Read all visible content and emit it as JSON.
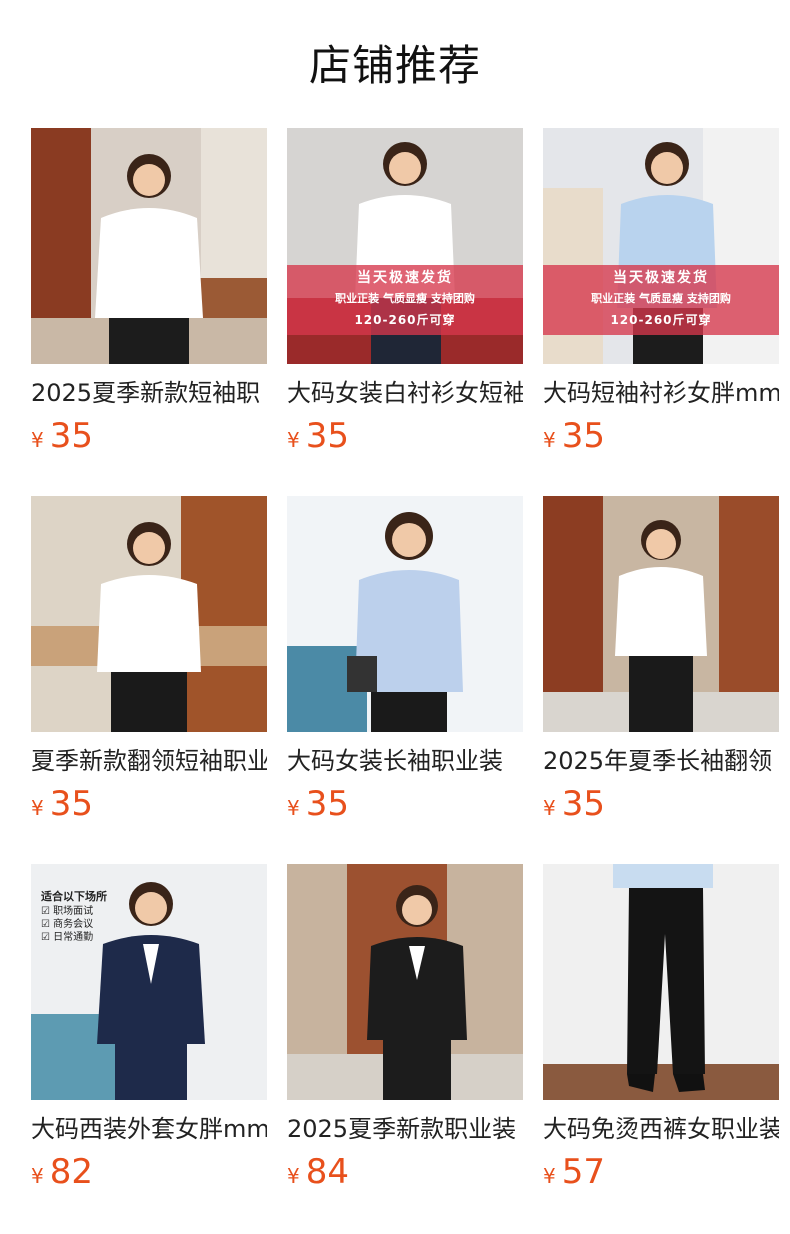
{
  "header": {
    "title": "店铺推荐"
  },
  "products": [
    {
      "name": "2025夏季新款短袖职",
      "currency": "¥",
      "price": "35"
    },
    {
      "name": "大码女装白衬衫女短袖",
      "currency": "¥",
      "price": "35",
      "banner": {
        "line1": "当天极速发货",
        "line2": "职业正装  气质显瘦  支持团购",
        "line3": "120-260斤可穿"
      }
    },
    {
      "name": "大码短袖衬衫女胖mm",
      "currency": "¥",
      "price": "35",
      "banner": {
        "line1": "当天极速发货",
        "line2": "职业正装  气质显瘦  支持团购",
        "line3": "120-260斤可穿"
      }
    },
    {
      "name": "夏季新款翻领短袖职业",
      "currency": "¥",
      "price": "35"
    },
    {
      "name": "大码女装长袖职业装",
      "currency": "¥",
      "price": "35"
    },
    {
      "name": "2025年夏季长袖翻领",
      "currency": "¥",
      "price": "35"
    },
    {
      "name": "大码西装外套女胖mm",
      "currency": "¥",
      "price": "82",
      "overlay": {
        "title": "适合以下场所",
        "items": [
          "☑ 职场面试",
          "☑ 商务会议",
          "☑ 日常通勤"
        ]
      }
    },
    {
      "name": "2025夏季新款职业装",
      "currency": "¥",
      "price": "84"
    },
    {
      "name": "大码免烫西裤女职业装",
      "currency": "¥",
      "price": "57"
    }
  ],
  "colors": {
    "price": "#e8501c",
    "banner": "#d6374b"
  }
}
